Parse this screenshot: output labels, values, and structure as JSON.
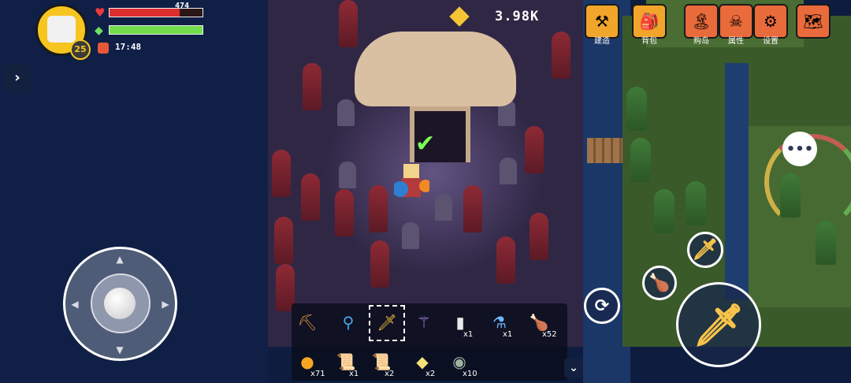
{
  "player": {
    "level": "25",
    "hp_text": "474",
    "hp_fraction": 0.75,
    "energy_fraction": 1.0,
    "time": "17:48"
  },
  "currency": {
    "gems": "3.98K"
  },
  "menu": [
    {
      "label": "建造",
      "icon": "anvil-icon",
      "color": "#f1a52a",
      "glyph": "⚒"
    },
    {
      "label": "背包",
      "icon": "backpack-icon",
      "color": "#f1a52a",
      "glyph": "🎒"
    },
    {
      "label": "购岛",
      "icon": "island-icon",
      "color": "#e96a3b",
      "glyph": "🏝"
    },
    {
      "label": "属性",
      "icon": "skull-icon",
      "color": "#e96a3b",
      "glyph": "☠"
    },
    {
      "label": "设置",
      "icon": "gear-icon",
      "color": "#e96a3b",
      "glyph": "⚙"
    },
    {
      "label": "",
      "icon": "map-icon",
      "color": "#e96a3b",
      "glyph": "🗺"
    }
  ],
  "hotbar_row1": [
    {
      "name": "pickaxe-icon",
      "glyph": "⛏",
      "color": "#c9873b",
      "count": ""
    },
    {
      "name": "shovel-icon",
      "glyph": "⚲",
      "color": "#4aa3e8",
      "count": ""
    },
    {
      "name": "sword-icon",
      "glyph": "🗡",
      "color": "#f5c542",
      "count": ""
    },
    {
      "name": "staff-icon",
      "glyph": "⚚",
      "color": "#b58cf0",
      "count": ""
    },
    {
      "name": "bottle-icon",
      "glyph": "▮",
      "color": "#e8e8e8",
      "count": "x1"
    },
    {
      "name": "potion-icon",
      "glyph": "⚗",
      "color": "#6fb6ff",
      "count": "x1"
    },
    {
      "name": "meat-icon",
      "glyph": "🍗",
      "color": "#c86b3c",
      "count": "x52"
    }
  ],
  "hotbar_row2": [
    {
      "name": "orange-icon",
      "glyph": "●",
      "color": "#f5a623",
      "count": "x71"
    },
    {
      "name": "scroll-icon",
      "glyph": "📜",
      "color": "#d9a57a",
      "count": "x1"
    },
    {
      "name": "scroll-icon",
      "glyph": "📜",
      "color": "#d9a57a",
      "count": "x2"
    },
    {
      "name": "cake-icon",
      "glyph": "◆",
      "color": "#f5e07a",
      "count": "x2"
    },
    {
      "name": "orb-icon",
      "glyph": "◉",
      "color": "#9fb39f",
      "count": "x10"
    }
  ],
  "actions": {
    "chat_icon": "chat-icon",
    "dash_icon": "dash-icon"
  }
}
